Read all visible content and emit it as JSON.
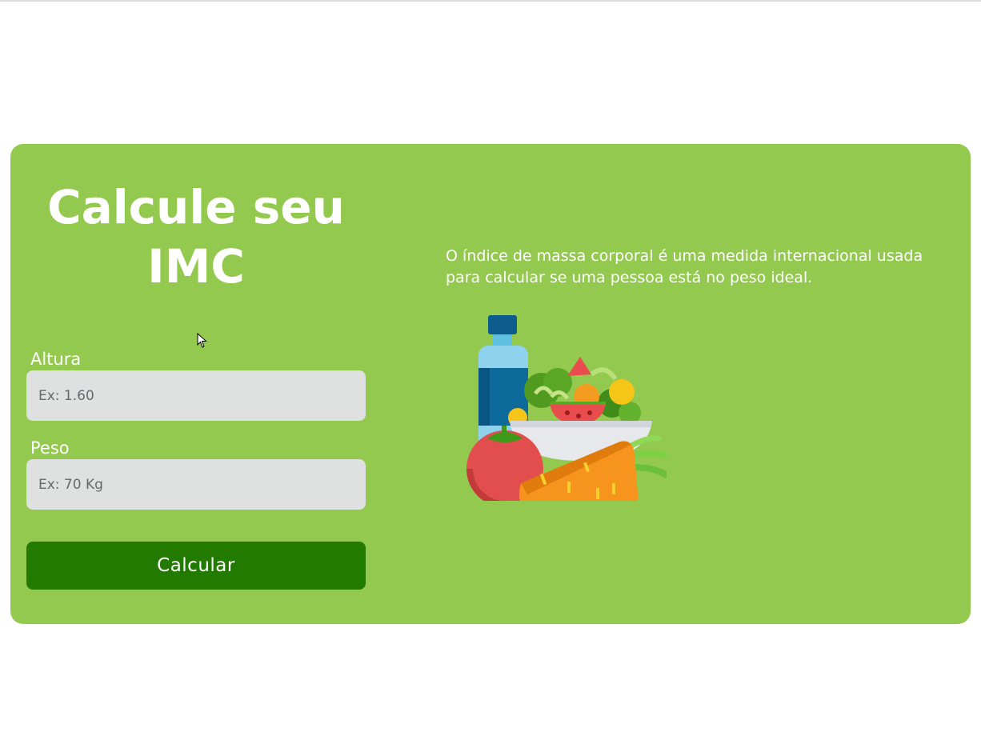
{
  "card": {
    "title": "Calcule seu IMC",
    "description": "O índice de massa corporal é uma medida internacional usada para calcular se uma pessoa está no peso ideal."
  },
  "form": {
    "height_label": "Altura",
    "height_placeholder": "Ex: 1.60",
    "weight_label": "Peso",
    "weight_placeholder": "Ex: 70 Kg",
    "submit_label": "Calcular"
  },
  "illustration": {
    "icon": "healthy-food-icon"
  },
  "colors": {
    "card_background": "#94c94f",
    "button_background": "#227a00",
    "input_background": "#dfe1e0",
    "text": "#ffffff"
  }
}
